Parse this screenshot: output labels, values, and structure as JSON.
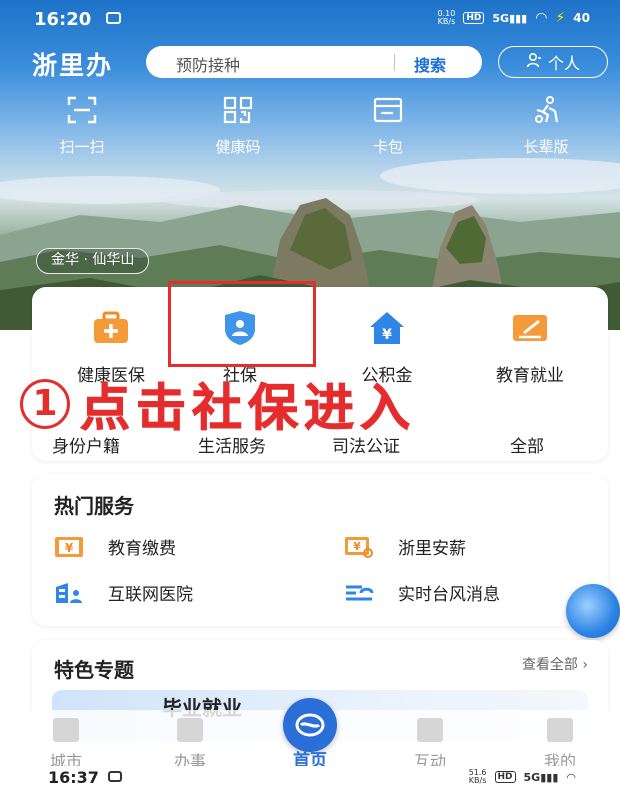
{
  "status_bar": {
    "time": "16:20",
    "speed_value": "0.10",
    "speed_unit": "KB/s",
    "hd": "HD",
    "signal": "5G",
    "battery": "40"
  },
  "topbar": {
    "app_name": "浙里办",
    "search_placeholder": "预防接种",
    "search_button": "搜索",
    "personal_button": "个人"
  },
  "quick_actions": [
    {
      "label": "扫一扫",
      "icon": "scan-icon"
    },
    {
      "label": "健康码",
      "icon": "qr-code-icon"
    },
    {
      "label": "卡包",
      "icon": "card-wallet-icon"
    },
    {
      "label": "长辈版",
      "icon": "elderly-mode-icon"
    }
  ],
  "location_chip": "金华 · 仙华山",
  "services_row1": [
    {
      "label": "健康医保",
      "icon": "medical-kit-icon"
    },
    {
      "label": "社保",
      "icon": "social-security-shield-icon"
    },
    {
      "label": "公积金",
      "icon": "housing-fund-icon"
    },
    {
      "label": "教育就业",
      "icon": "education-icon"
    }
  ],
  "services_row2": [
    {
      "label": "身份户籍"
    },
    {
      "label": "生活服务"
    },
    {
      "label": "司法公证"
    },
    {
      "label": "全部"
    }
  ],
  "annotation": {
    "number": "1",
    "text": "点击社保进入"
  },
  "hot_services": {
    "title": "热门服务",
    "items": [
      {
        "label": "教育缴费",
        "icon": "tuition-payment-icon"
      },
      {
        "label": "浙里安薪",
        "icon": "salary-icon"
      },
      {
        "label": "互联网医院",
        "icon": "hospital-icon"
      },
      {
        "label": "实时台风消息",
        "icon": "typhoon-news-icon"
      }
    ]
  },
  "featured": {
    "title": "特色专题",
    "see_all": "查看全部 ›",
    "banner_label": "毕业就业"
  },
  "bottom_nav": [
    {
      "label": "城市"
    },
    {
      "label": "办事"
    },
    {
      "label": "首页"
    },
    {
      "label": "互动"
    },
    {
      "label": "我的"
    }
  ],
  "bottom_status": {
    "time": "16:37",
    "speed_value": "51.6",
    "speed_unit": "KB/s",
    "hd": "HD",
    "signal": "5G"
  },
  "colors": {
    "primary_blue": "#1f6fd6",
    "annotation_red": "#e52d2d",
    "orange_icon": "#f08a24",
    "blue_icon": "#2f86e6"
  }
}
